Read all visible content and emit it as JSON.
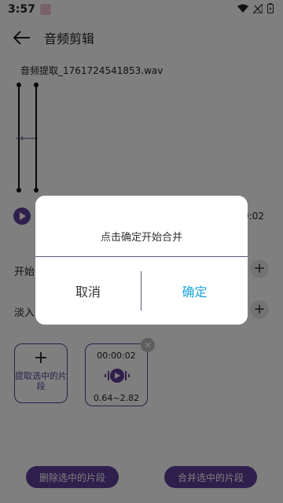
{
  "status": {
    "time": "3:57"
  },
  "appbar": {
    "title": "音频剪辑"
  },
  "file": {
    "name": "音频提取_1761724541853.wav"
  },
  "player": {
    "time_right": "00:02"
  },
  "rows": {
    "start_label": "开始",
    "fade_in_label": "淡入"
  },
  "extract": {
    "label": "提取选中的片段"
  },
  "segment": {
    "time": "00:00:02",
    "range": "0.64~2.82"
  },
  "bottom": {
    "delete_label": "删除选中的片段",
    "merge_label": "合并选中的片段"
  },
  "dialog": {
    "message": "点击确定开始合并",
    "cancel_label": "取消",
    "ok_label": "确定"
  },
  "colors": {
    "accent": "#5e3f99",
    "ok_blue": "#1aa3d9"
  }
}
